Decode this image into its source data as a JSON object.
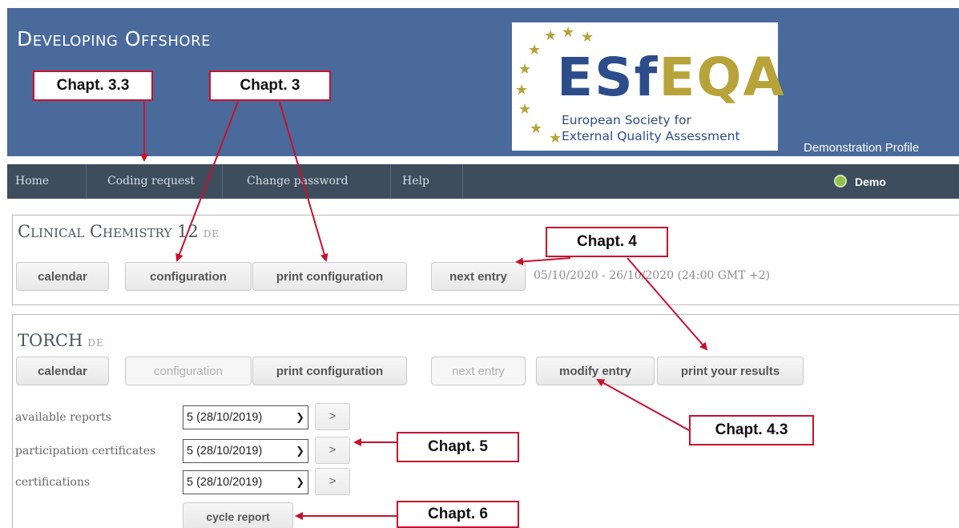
{
  "header": {
    "brand": "Developing Offshore",
    "logo_title_part1": "ESf",
    "logo_title_part2": "EQA",
    "logo_sub_line1": "European Society for",
    "logo_sub_line2": "External Quality Assessment",
    "profile": "Demonstration Profile"
  },
  "nav": {
    "items": [
      "Home",
      "Coding request",
      "Change password",
      "Help"
    ],
    "user": "Demo"
  },
  "panels": [
    {
      "title": "Clinical Chemistry 12",
      "country": "DE",
      "buttons": [
        "calendar",
        "configuration",
        "print configuration",
        "next entry"
      ],
      "dates": "05/10/2020 - 26/10/2020 (24:00 GMT +2)"
    },
    {
      "title": "TORCH",
      "country": "DE",
      "buttons": [
        "calendar",
        "configuration",
        "print configuration",
        "next entry",
        "modify entry",
        "print your results"
      ],
      "reports": [
        {
          "label": "available reports",
          "value": "5 (28/10/2019)",
          "go": ">"
        },
        {
          "label": "participation certificates",
          "value": "5 (28/10/2019)",
          "go": ">"
        },
        {
          "label": "certifications",
          "value": "5 (28/10/2019)",
          "go": ">"
        }
      ],
      "cycle_report": "cycle report"
    }
  ],
  "callouts": {
    "c33": "Chapt. 3.3",
    "c3": "Chapt. 3",
    "c4": "Chapt. 4",
    "c43": "Chapt. 4.3",
    "c5": "Chapt. 5",
    "c6": "Chapt. 6"
  },
  "colors": {
    "header_bg": "#4a6a9b",
    "nav_bg": "#3d4d5e",
    "callout_border": "#c8102e",
    "logo_gold": "#b7a33a",
    "logo_blue": "#2c4d8a"
  }
}
